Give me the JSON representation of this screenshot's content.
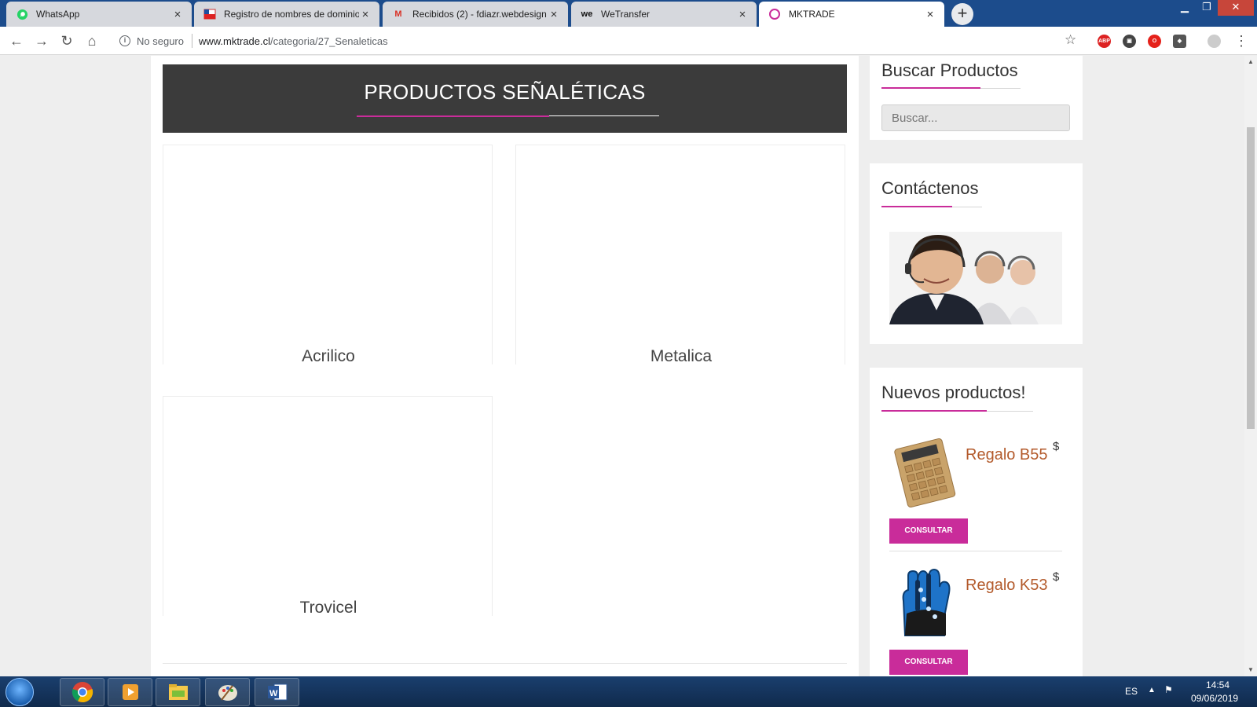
{
  "browser": {
    "tabs": [
      {
        "title": "WhatsApp",
        "icon": "whatsapp-icon",
        "active": false
      },
      {
        "title": "Registro de nombres de dominio",
        "icon": "nic-chile-icon",
        "active": false
      },
      {
        "title": "Recibidos (2) - fdiazr.webdesign",
        "icon": "gmail-icon",
        "active": false
      },
      {
        "title": "WeTransfer",
        "icon": "wetransfer-icon",
        "active": false
      },
      {
        "title": "MKTRADE",
        "icon": "mktrade-icon",
        "active": true
      }
    ],
    "security_label": "No seguro",
    "url_domain": "www.mktrade.cl",
    "url_path": "/categoria/27_Senaleticas"
  },
  "page": {
    "banner_title": "PRODUCTOS SEÑALÉTICAS",
    "categories": [
      {
        "name": "Acrilico"
      },
      {
        "name": "Metalica"
      },
      {
        "name": "Trovicel"
      }
    ],
    "accent_color": "#c92c9a"
  },
  "sidebar": {
    "search": {
      "title": "Buscar Productos",
      "placeholder": "Buscar..."
    },
    "contact": {
      "title": "Contáctenos",
      "image": "call-center-agents"
    },
    "new_products": {
      "title": "Nuevos productos!",
      "items": [
        {
          "name": "Regalo B55",
          "price": "$",
          "button": "CONSULTAR",
          "image": "calculator"
        },
        {
          "name": "Regalo K53",
          "price": "$",
          "button": "CONSULTAR",
          "image": "led-glove"
        }
      ]
    }
  },
  "taskbar": {
    "language": "ES",
    "time": "14:54",
    "date": "09/06/2019"
  }
}
